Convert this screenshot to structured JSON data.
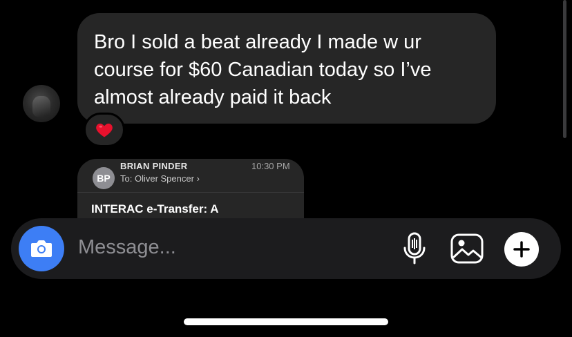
{
  "message": {
    "text": "Bro I sold a beat already I made w ur course for $60 Canadian today so I’ve almost already paid it back",
    "reaction_icon": "heart-emoji"
  },
  "shared_email": {
    "avatar_initials": "BP",
    "sender": "BRIAN PINDER",
    "time": "10:30 PM",
    "to_line": "To: Oliver Spencer",
    "subject": "INTERAC e-Transfer: A"
  },
  "composer": {
    "placeholder": "Message...",
    "icons": [
      "camera-icon",
      "microphone-icon",
      "gallery-icon",
      "plus-icon"
    ]
  },
  "colors": {
    "background": "#000000",
    "bubble": "#262626",
    "camera_button": "#3d7ef5",
    "placeholder": "#8e8e93"
  }
}
